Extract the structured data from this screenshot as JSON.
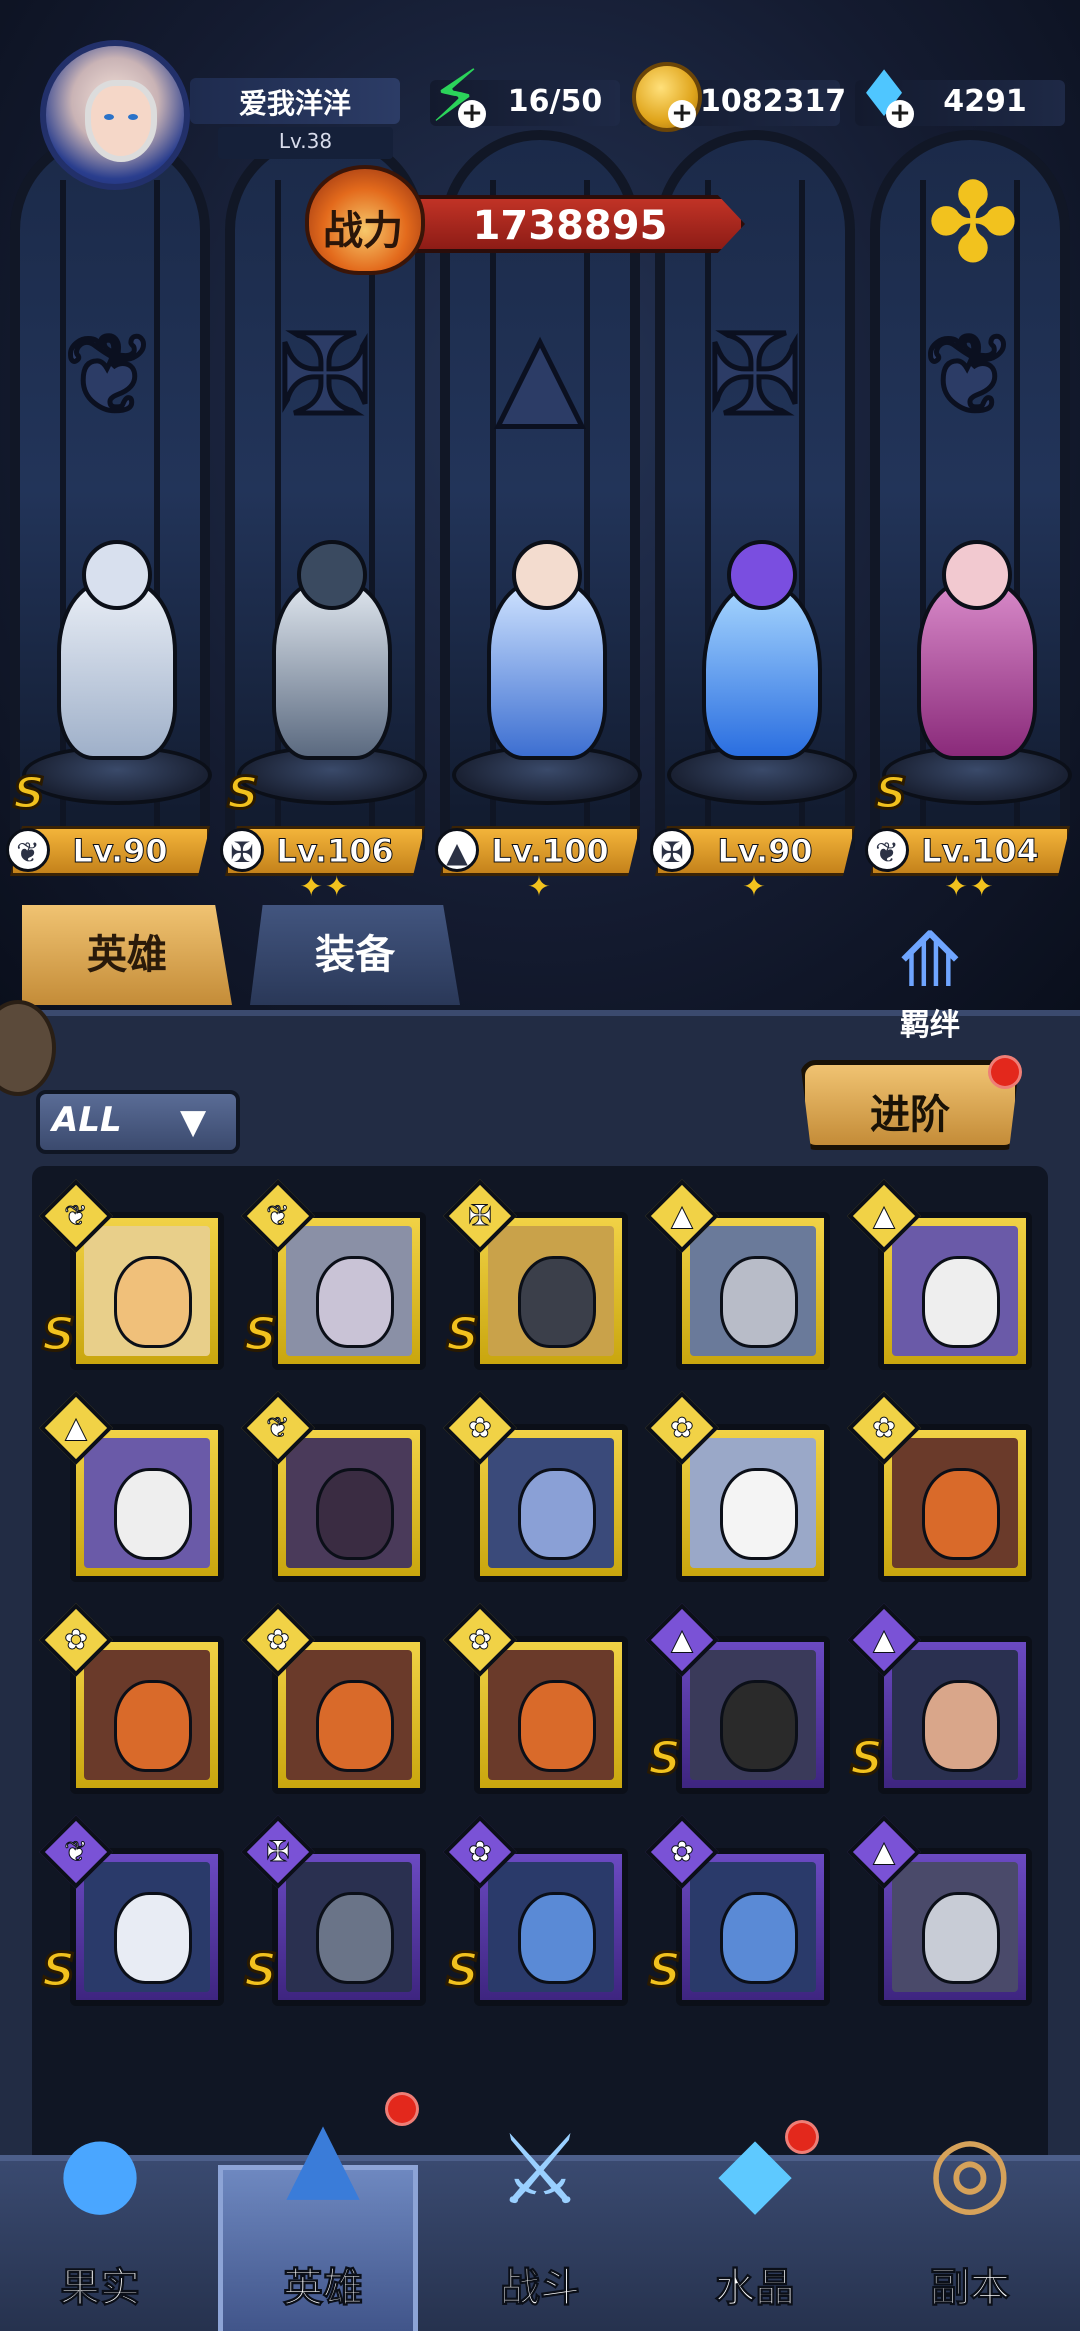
{
  "player": {
    "name": "爱我洋洋",
    "level": "Lv.38"
  },
  "resources": {
    "energy": "16/50",
    "gold": "1082317",
    "gems": "4291"
  },
  "power": {
    "label": "战力",
    "value": "1738895"
  },
  "heroes": [
    {
      "level": "Lv.90",
      "rank": "S",
      "stars": 0
    },
    {
      "level": "Lv.106",
      "rank": "S",
      "stars": 2
    },
    {
      "level": "Lv.100",
      "rank": "",
      "stars": 1
    },
    {
      "level": "Lv.90",
      "rank": "",
      "stars": 1
    },
    {
      "level": "Lv.104",
      "rank": "S",
      "stars": 2
    }
  ],
  "tabs": {
    "hero": "英雄",
    "equipment": "装备"
  },
  "bond": {
    "label": "羁绊"
  },
  "filter": {
    "label": "ALL"
  },
  "advance": {
    "label": "进阶"
  },
  "grid": [
    {
      "frame": "gold",
      "rank": "S"
    },
    {
      "frame": "gold",
      "rank": "S"
    },
    {
      "frame": "gold",
      "rank": "S"
    },
    {
      "frame": "gold",
      "rank": ""
    },
    {
      "frame": "gold",
      "rank": ""
    },
    {
      "frame": "gold",
      "rank": ""
    },
    {
      "frame": "gold",
      "rank": ""
    },
    {
      "frame": "gold",
      "rank": ""
    },
    {
      "frame": "gold",
      "rank": ""
    },
    {
      "frame": "gold",
      "rank": ""
    },
    {
      "frame": "gold",
      "rank": ""
    },
    {
      "frame": "gold",
      "rank": ""
    },
    {
      "frame": "gold",
      "rank": ""
    },
    {
      "frame": "purple",
      "rank": "S"
    },
    {
      "frame": "purple",
      "rank": "S"
    },
    {
      "frame": "purple",
      "rank": "S"
    },
    {
      "frame": "purple",
      "rank": "S"
    },
    {
      "frame": "purple",
      "rank": "S"
    },
    {
      "frame": "purple",
      "rank": "S"
    },
    {
      "frame": "purple",
      "rank": ""
    }
  ],
  "nav": {
    "fruit": "果实",
    "hero": "英雄",
    "battle": "战斗",
    "crystal": "水晶",
    "dungeon": "副本"
  },
  "colors": {
    "gold_frame": "#f1d246",
    "purple_frame": "#6b4ac2",
    "accent": "#f2c21e",
    "power_red": "#c13326"
  }
}
